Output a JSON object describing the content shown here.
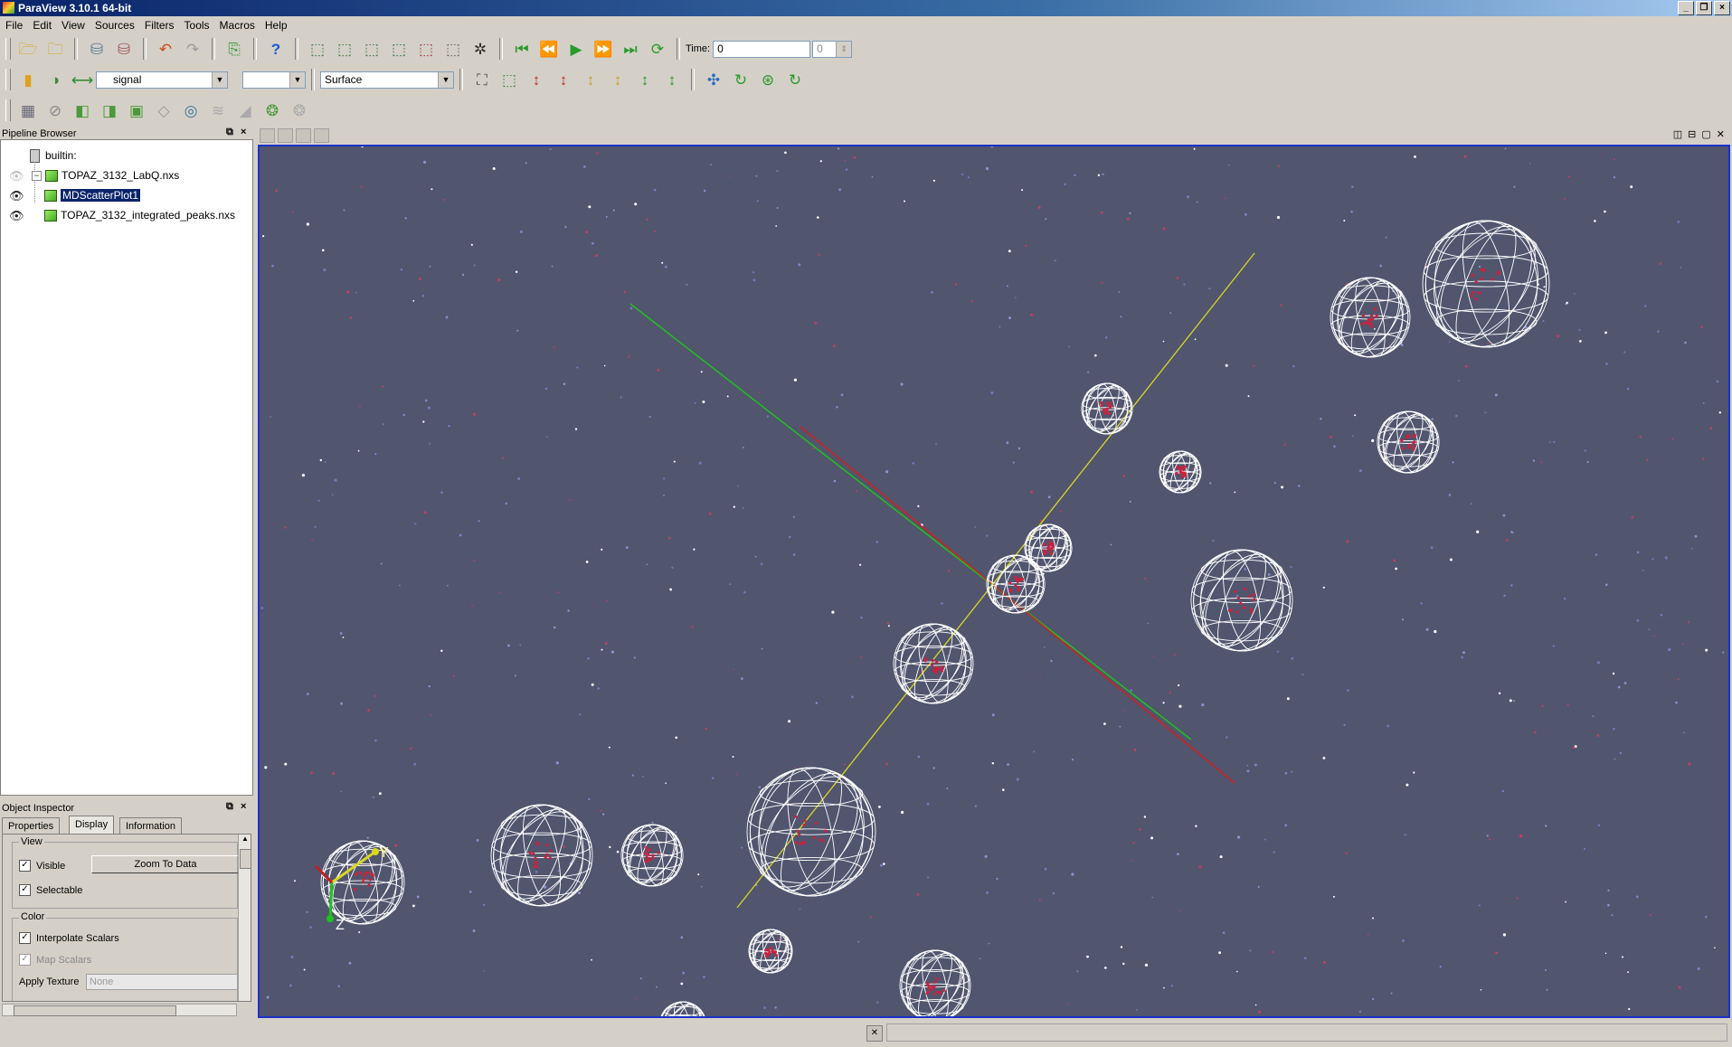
{
  "window": {
    "title": "ParaView 3.10.1 64-bit"
  },
  "menu": [
    "File",
    "Edit",
    "View",
    "Sources",
    "Filters",
    "Tools",
    "Macros",
    "Help"
  ],
  "toolbar1": {
    "time_label": "Time:",
    "time_value": "0",
    "time_step": "0"
  },
  "toolbar2": {
    "array_value": "signal",
    "component_value": "",
    "representation_value": "Surface"
  },
  "pipeline": {
    "title": "Pipeline Browser",
    "root": "builtin:",
    "items": [
      {
        "label": "TOPAZ_3132_LabQ.nxs",
        "visible": "faint"
      },
      {
        "label": "MDScatterPlot1",
        "visible": "on",
        "selected": true
      },
      {
        "label": "TOPAZ_3132_integrated_peaks.nxs",
        "visible": "on"
      }
    ]
  },
  "inspector": {
    "title": "Object Inspector",
    "tabs": [
      "Properties",
      "Display",
      "Information"
    ],
    "active_tab": "Display",
    "view_group": "View",
    "visible_label": "Visible",
    "selectable_label": "Selectable",
    "zoom_button": "Zoom To Data",
    "color_group": "Color",
    "interpolate_label": "Interpolate Scalars",
    "map_scalars_label": "Map Scalars",
    "apply_texture_label": "Apply Texture",
    "texture_value": "None"
  },
  "orientation_axes": {
    "y_label": "Y",
    "z_label": "Z"
  },
  "colors": {
    "background": "#51556e",
    "wireframe": "#ffffff",
    "peak": "#d0203a",
    "axis_x": "#d02020",
    "axis_y": "#d8d820",
    "axis_z": "#20c020",
    "view_border": "#1c32c8"
  },
  "icons": {
    "toolbar1": [
      "open-icon",
      "open-recent-icon",
      "connect-icon",
      "disconnect-icon",
      "undo-icon",
      "redo-icon",
      "camera-undo-icon",
      "help-icon",
      "select-cells-icon",
      "select-points-icon",
      "select-frustum-icon",
      "select-block-icon",
      "select-interactive-icon",
      "clear-selection-icon",
      "pick-icon",
      "first-frame-icon",
      "prev-frame-icon",
      "play-icon",
      "next-frame-icon",
      "last-frame-icon",
      "loop-icon"
    ],
    "toolbar2": [
      "color-legend-icon",
      "edit-colormap-icon",
      "rescale-icon",
      "reset-camera-icon",
      "zoom-select-icon",
      "view-minus-x-icon",
      "view-plus-x-icon",
      "view-minus-y-icon",
      "view-plus-y-icon",
      "view-minus-z-icon",
      "view-plus-z-icon",
      "center-axes-icon",
      "rotate-icon",
      "pick-center-icon",
      "show-center-icon"
    ],
    "toolbar3": [
      "calculator-icon",
      "contour-icon",
      "clip-icon",
      "slice-icon",
      "threshold-icon",
      "extract-subset-icon",
      "glyph-icon",
      "stream-tracer-icon",
      "warp-icon",
      "group-icon",
      "extract-level-icon"
    ]
  }
}
